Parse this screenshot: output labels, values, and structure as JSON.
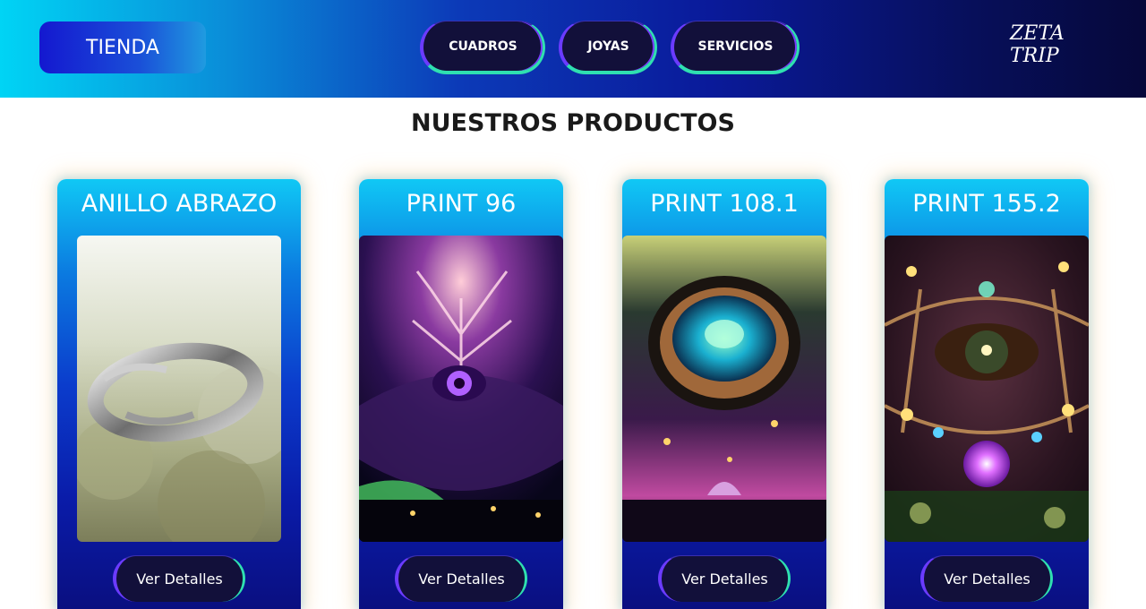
{
  "header": {
    "store_label": "TIENDA",
    "nav": [
      {
        "label": "CUADROS"
      },
      {
        "label": "JOYAS"
      },
      {
        "label": "SERVICIOS"
      }
    ],
    "logo_text": "ZETA TRIP"
  },
  "main": {
    "title": "NUESTROS PRODUCTOS",
    "products": [
      {
        "title": "ANILLO ABRAZO",
        "button": "Ver Detalles",
        "image": "silver-embracing-arms-ring"
      },
      {
        "title": "PRINT 96",
        "button": "Ver Detalles",
        "image": "psychedelic-tree-eye"
      },
      {
        "title": "PRINT 108.1",
        "button": "Ver Detalles",
        "image": "psychedelic-cosmic-eye"
      },
      {
        "title": "PRINT 155.2",
        "button": "Ver Detalles",
        "image": "psychedelic-eye-flower"
      }
    ]
  },
  "colors": {
    "header_start": "#00d4f5",
    "header_end": "#06083a",
    "card_top": "#10c8f5",
    "card_bottom": "#0a0f80",
    "button_bg": "#12103a",
    "accent_purple": "#6b3bff",
    "accent_green": "#2fe0b0"
  }
}
